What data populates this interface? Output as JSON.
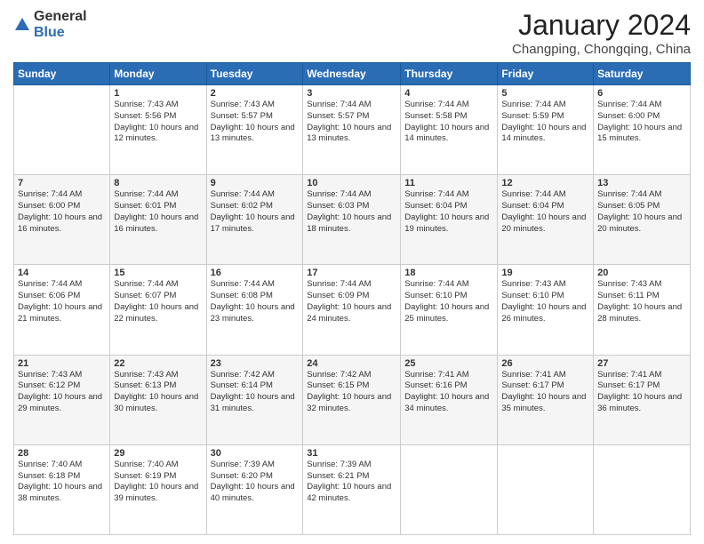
{
  "logo": {
    "general": "General",
    "blue": "Blue"
  },
  "title": "January 2024",
  "location": "Changping, Chongqing, China",
  "days_of_week": [
    "Sunday",
    "Monday",
    "Tuesday",
    "Wednesday",
    "Thursday",
    "Friday",
    "Saturday"
  ],
  "weeks": [
    [
      {
        "day": "",
        "sunrise": "",
        "sunset": "",
        "daylight": ""
      },
      {
        "day": "1",
        "sunrise": "Sunrise: 7:43 AM",
        "sunset": "Sunset: 5:56 PM",
        "daylight": "Daylight: 10 hours and 12 minutes."
      },
      {
        "day": "2",
        "sunrise": "Sunrise: 7:43 AM",
        "sunset": "Sunset: 5:57 PM",
        "daylight": "Daylight: 10 hours and 13 minutes."
      },
      {
        "day": "3",
        "sunrise": "Sunrise: 7:44 AM",
        "sunset": "Sunset: 5:57 PM",
        "daylight": "Daylight: 10 hours and 13 minutes."
      },
      {
        "day": "4",
        "sunrise": "Sunrise: 7:44 AM",
        "sunset": "Sunset: 5:58 PM",
        "daylight": "Daylight: 10 hours and 14 minutes."
      },
      {
        "day": "5",
        "sunrise": "Sunrise: 7:44 AM",
        "sunset": "Sunset: 5:59 PM",
        "daylight": "Daylight: 10 hours and 14 minutes."
      },
      {
        "day": "6",
        "sunrise": "Sunrise: 7:44 AM",
        "sunset": "Sunset: 6:00 PM",
        "daylight": "Daylight: 10 hours and 15 minutes."
      }
    ],
    [
      {
        "day": "7",
        "sunrise": "Sunrise: 7:44 AM",
        "sunset": "Sunset: 6:00 PM",
        "daylight": "Daylight: 10 hours and 16 minutes."
      },
      {
        "day": "8",
        "sunrise": "Sunrise: 7:44 AM",
        "sunset": "Sunset: 6:01 PM",
        "daylight": "Daylight: 10 hours and 16 minutes."
      },
      {
        "day": "9",
        "sunrise": "Sunrise: 7:44 AM",
        "sunset": "Sunset: 6:02 PM",
        "daylight": "Daylight: 10 hours and 17 minutes."
      },
      {
        "day": "10",
        "sunrise": "Sunrise: 7:44 AM",
        "sunset": "Sunset: 6:03 PM",
        "daylight": "Daylight: 10 hours and 18 minutes."
      },
      {
        "day": "11",
        "sunrise": "Sunrise: 7:44 AM",
        "sunset": "Sunset: 6:04 PM",
        "daylight": "Daylight: 10 hours and 19 minutes."
      },
      {
        "day": "12",
        "sunrise": "Sunrise: 7:44 AM",
        "sunset": "Sunset: 6:04 PM",
        "daylight": "Daylight: 10 hours and 20 minutes."
      },
      {
        "day": "13",
        "sunrise": "Sunrise: 7:44 AM",
        "sunset": "Sunset: 6:05 PM",
        "daylight": "Daylight: 10 hours and 20 minutes."
      }
    ],
    [
      {
        "day": "14",
        "sunrise": "Sunrise: 7:44 AM",
        "sunset": "Sunset: 6:06 PM",
        "daylight": "Daylight: 10 hours and 21 minutes."
      },
      {
        "day": "15",
        "sunrise": "Sunrise: 7:44 AM",
        "sunset": "Sunset: 6:07 PM",
        "daylight": "Daylight: 10 hours and 22 minutes."
      },
      {
        "day": "16",
        "sunrise": "Sunrise: 7:44 AM",
        "sunset": "Sunset: 6:08 PM",
        "daylight": "Daylight: 10 hours and 23 minutes."
      },
      {
        "day": "17",
        "sunrise": "Sunrise: 7:44 AM",
        "sunset": "Sunset: 6:09 PM",
        "daylight": "Daylight: 10 hours and 24 minutes."
      },
      {
        "day": "18",
        "sunrise": "Sunrise: 7:44 AM",
        "sunset": "Sunset: 6:10 PM",
        "daylight": "Daylight: 10 hours and 25 minutes."
      },
      {
        "day": "19",
        "sunrise": "Sunrise: 7:43 AM",
        "sunset": "Sunset: 6:10 PM",
        "daylight": "Daylight: 10 hours and 26 minutes."
      },
      {
        "day": "20",
        "sunrise": "Sunrise: 7:43 AM",
        "sunset": "Sunset: 6:11 PM",
        "daylight": "Daylight: 10 hours and 28 minutes."
      }
    ],
    [
      {
        "day": "21",
        "sunrise": "Sunrise: 7:43 AM",
        "sunset": "Sunset: 6:12 PM",
        "daylight": "Daylight: 10 hours and 29 minutes."
      },
      {
        "day": "22",
        "sunrise": "Sunrise: 7:43 AM",
        "sunset": "Sunset: 6:13 PM",
        "daylight": "Daylight: 10 hours and 30 minutes."
      },
      {
        "day": "23",
        "sunrise": "Sunrise: 7:42 AM",
        "sunset": "Sunset: 6:14 PM",
        "daylight": "Daylight: 10 hours and 31 minutes."
      },
      {
        "day": "24",
        "sunrise": "Sunrise: 7:42 AM",
        "sunset": "Sunset: 6:15 PM",
        "daylight": "Daylight: 10 hours and 32 minutes."
      },
      {
        "day": "25",
        "sunrise": "Sunrise: 7:41 AM",
        "sunset": "Sunset: 6:16 PM",
        "daylight": "Daylight: 10 hours and 34 minutes."
      },
      {
        "day": "26",
        "sunrise": "Sunrise: 7:41 AM",
        "sunset": "Sunset: 6:17 PM",
        "daylight": "Daylight: 10 hours and 35 minutes."
      },
      {
        "day": "27",
        "sunrise": "Sunrise: 7:41 AM",
        "sunset": "Sunset: 6:17 PM",
        "daylight": "Daylight: 10 hours and 36 minutes."
      }
    ],
    [
      {
        "day": "28",
        "sunrise": "Sunrise: 7:40 AM",
        "sunset": "Sunset: 6:18 PM",
        "daylight": "Daylight: 10 hours and 38 minutes."
      },
      {
        "day": "29",
        "sunrise": "Sunrise: 7:40 AM",
        "sunset": "Sunset: 6:19 PM",
        "daylight": "Daylight: 10 hours and 39 minutes."
      },
      {
        "day": "30",
        "sunrise": "Sunrise: 7:39 AM",
        "sunset": "Sunset: 6:20 PM",
        "daylight": "Daylight: 10 hours and 40 minutes."
      },
      {
        "day": "31",
        "sunrise": "Sunrise: 7:39 AM",
        "sunset": "Sunset: 6:21 PM",
        "daylight": "Daylight: 10 hours and 42 minutes."
      },
      {
        "day": "",
        "sunrise": "",
        "sunset": "",
        "daylight": ""
      },
      {
        "day": "",
        "sunrise": "",
        "sunset": "",
        "daylight": ""
      },
      {
        "day": "",
        "sunrise": "",
        "sunset": "",
        "daylight": ""
      }
    ]
  ]
}
